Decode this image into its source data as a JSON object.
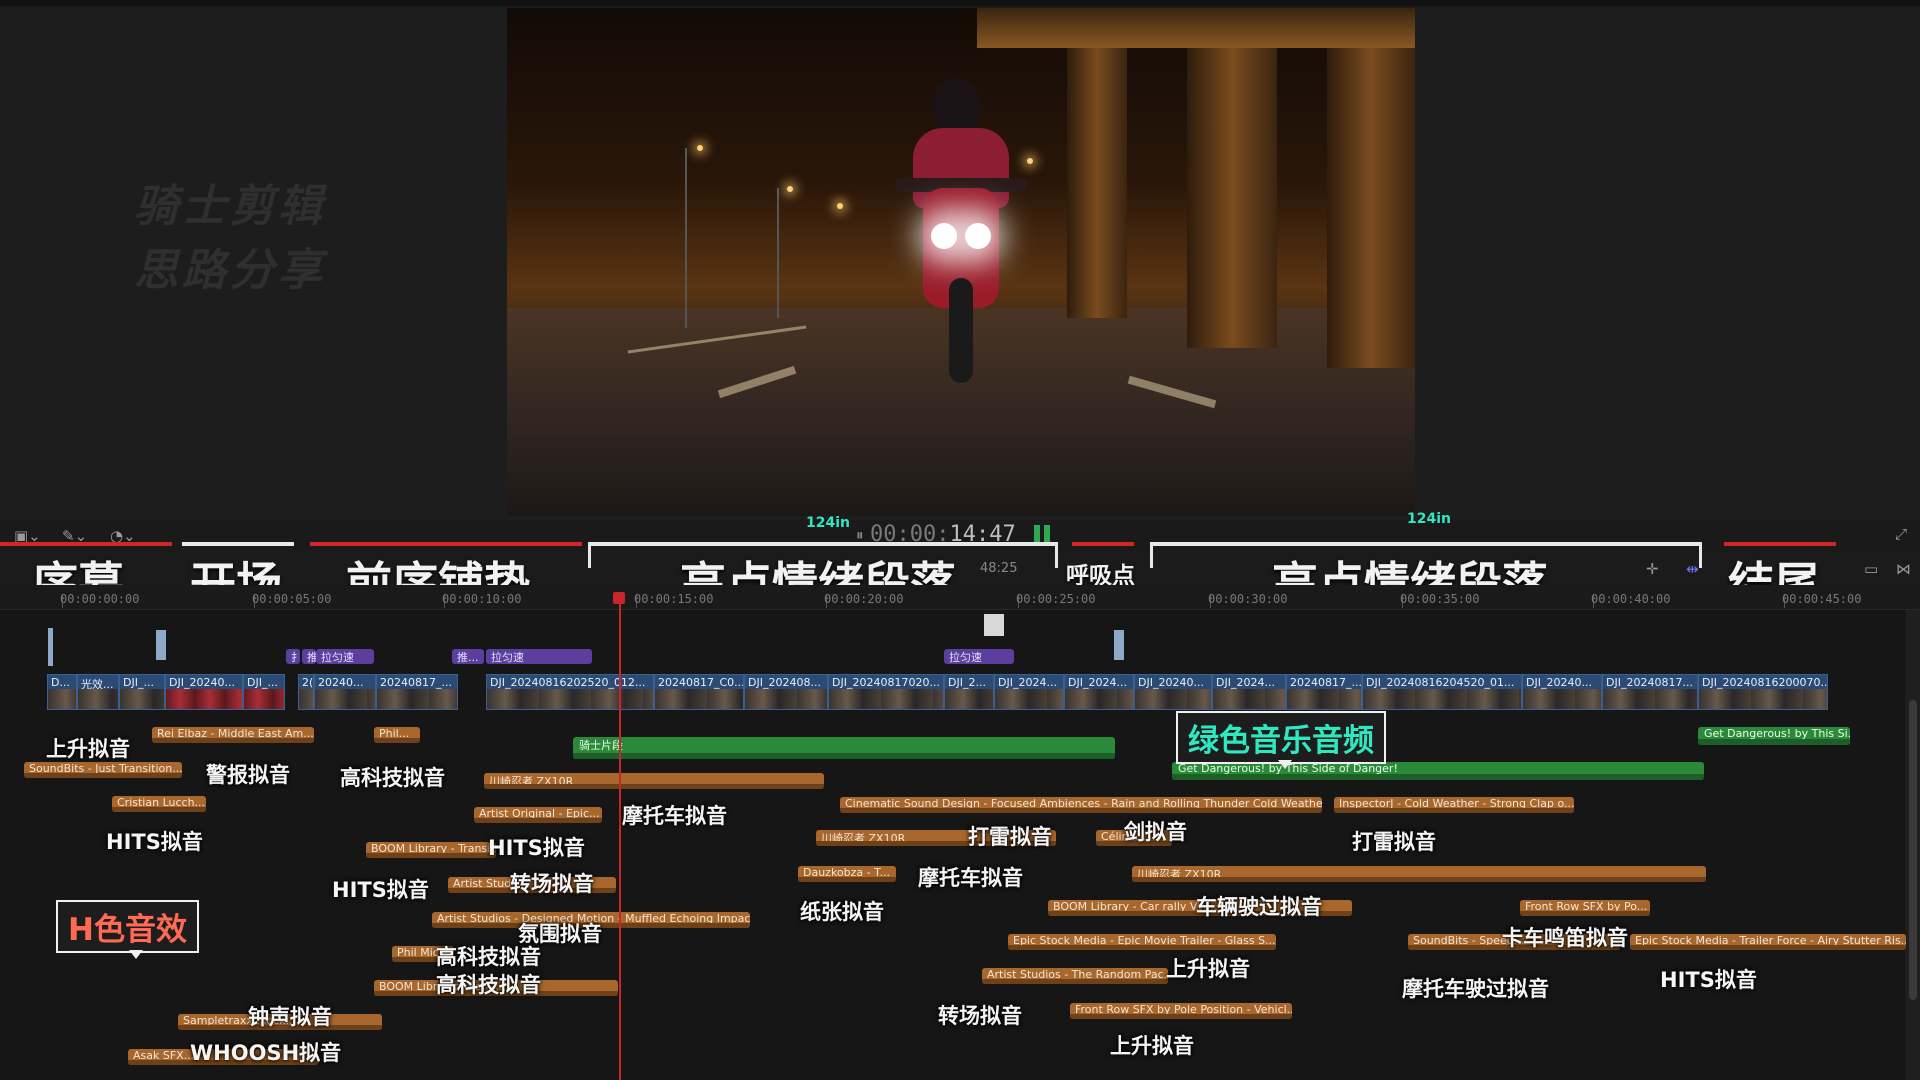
{
  "viewer": {
    "watermark_line1": "骑士剪辑",
    "watermark_line2": "思路分享"
  },
  "toolbar": {
    "timecode_dim": "00:00:",
    "timecode_bright": "14:47",
    "speed_left": "124in",
    "speed_right": "124in",
    "duration": "48:25"
  },
  "sections": {
    "xumu": "序幕",
    "kaichang": "开场",
    "qianxu": "前序铺垫",
    "gaodian1": "高点情绪段落",
    "huxi": "呼吸点",
    "gaodian2": "高点情绪段落",
    "jiewei": "结尾"
  },
  "ruler": [
    "00:00:00:00",
    "00:00:05:00",
    "00:00:10:00",
    "00:00:15:00",
    "00:00:20:00",
    "00:00:25:00",
    "00:00:30:00",
    "00:00:35:00",
    "00:00:40:00",
    "00:00:45:00"
  ],
  "purple_clips": [
    "拉匀速",
    "推...",
    "拉匀速",
    "拉匀速"
  ],
  "video_clips": [
    "D...",
    "光效...",
    "DJI_...",
    "DJI_20240...",
    "DJI_...",
    "2(",
    "20240...",
    "20240817_...",
    "DJI_20240816202520_012...",
    "20240817_C0...",
    "DJI_202408...",
    "DJI_20240817020...",
    "DJI_2...",
    "DJI_2024...",
    "DJI_2024...",
    "DJI_20240...",
    "DJI_2024...",
    "20240817_...",
    "DJI_20240816204520_01...",
    "DJI_20240...",
    "DJI_20240817...",
    "DJI_20240816200070..."
  ],
  "green_clips": {
    "qishi": "骑士片段",
    "getd": "Get Dangerous! by This Side of Danger!",
    "getd2": "Get Dangerous! by This Si..."
  },
  "audio_clips": {
    "a1": "Rei Elbaz - Middle East Am...",
    "a2": "Phil...",
    "a3": "SoundBits - Just Transition...",
    "a4": "Cristian Lucch...",
    "a5": "川崎忍者 ZX10R",
    "a6": "Artist Original - Epic...",
    "a7": "BOOM Library - Transit...",
    "a8": "Artist Studi...",
    "a9": "Artist Studios - Designed Motion - Muffled Echoing Impact",
    "a10": "Phil Mic...",
    "a11": "BOOM Libr...act Eerie...",
    "a12": "Sampletraxx...lock...",
    "a13": "Asak SFX...",
    "a14": "Cinematic Sound Design - Focused Ambiences - Rain and Rolling Thunder Cold Weather",
    "a15": "InspectorJ - Cold Weather - Strong Clap o...",
    "a16": "川崎忍者 ZX10R",
    "a17": "Céline...",
    "a18": "Dauzkobza - T...",
    "a19": "川崎忍者 ZX10R",
    "a20": "BOOM Library - Car rally VW...",
    "a21": "Front Row SFX by Po...",
    "a22": "Epic Stock Media - Epic Movie Trailer - Glass S...",
    "a23": "SoundBits - Speed...",
    "a24": "Epic Stock Media - Trailer Force - Airy Stutter Ris...",
    "a25": "Artist Studios - The Random Pac...",
    "a26": "Front Row SFX by Pole Position - Vehicl..."
  },
  "notes": {
    "n1": "上升拟音",
    "n2": "警报拟音",
    "n3": "高科技拟音",
    "n4": "HITS拟音",
    "n5": "HITS拟音",
    "n6": "HITS拟音",
    "n7": "转场拟音",
    "n8": "氛围拟音",
    "n9": "高科技拟音",
    "n10": "高科技拟音",
    "n11": "钟声拟音",
    "n12": "WHOOSH拟音",
    "n13": "摩托车拟音",
    "n14": "打雷拟音",
    "n15": "剑拟音",
    "n16": "打雷拟音",
    "n17": "摩托车拟音",
    "n18": "纸张拟音",
    "n19": "车辆驶过拟音",
    "n20": "卡车鸣笛拟音",
    "n21": "上升拟音",
    "n22": "摩托车驶过拟音",
    "n23": "HITS拟音",
    "n24": "转场拟音",
    "n25": "上升拟音"
  },
  "callouts": {
    "sfx": "H色音效",
    "music": "绿色音乐音频"
  },
  "colors": {
    "accent_red": "#d4242a",
    "sfx_label": "#ff6a55",
    "music_label": "#2ee8c0",
    "audio_clip": "#a8672c",
    "music_clip": "#2a8a3a",
    "title_clip": "#5a3f9e"
  }
}
